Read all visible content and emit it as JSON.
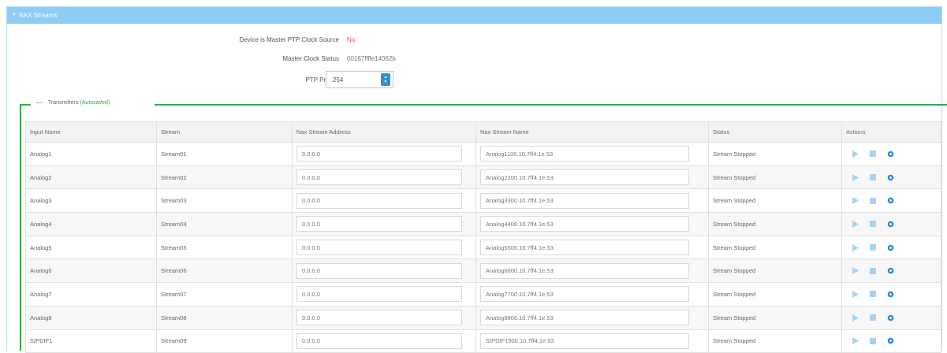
{
  "panel": {
    "title": "NAX Streams"
  },
  "master": {
    "master_label": "Device is Master PTP Clock Source",
    "master_value": "No",
    "status_label": "Master Clock Status",
    "status_value": "00187ffffe14062b",
    "priority_label": "PTP Priority",
    "priority_value": "254"
  },
  "transmitters": {
    "legend": "Transmitters",
    "autosaved": "(Autosaved)",
    "columns": [
      "Input Name",
      "Stream",
      "Nax Stream Address",
      "Nax Stream Name",
      "Status",
      "Actions"
    ],
    "rows": [
      {
        "input": "Analog1",
        "stream": "Stream01",
        "address": "0.0.0.0",
        "name": "Analog1100.10.7ff4.1e.53",
        "status": "Stream Stopped"
      },
      {
        "input": "Analog2",
        "stream": "Stream02",
        "address": "0.0.0.0",
        "name": "Analog2200.10.7ff4.1e.53",
        "status": "Stream Stopped"
      },
      {
        "input": "Analog3",
        "stream": "Stream03",
        "address": "0.0.0.0",
        "name": "Analog3300.10.7ff4.1e.53",
        "status": "Stream Stopped"
      },
      {
        "input": "Analog4",
        "stream": "Stream04",
        "address": "0.0.0.0",
        "name": "Analog4400.10.7ff4.1e.53",
        "status": "Stream Stopped"
      },
      {
        "input": "Analog5",
        "stream": "Stream05",
        "address": "0.0.0.0",
        "name": "Analog5500.10.7ff4.1e.53",
        "status": "Stream Stopped"
      },
      {
        "input": "Analog6",
        "stream": "Stream06",
        "address": "0.0.0.0",
        "name": "Analog6600.10.7ff4.1e.53",
        "status": "Stream Stopped"
      },
      {
        "input": "Analog7",
        "stream": "Stream07",
        "address": "0.0.0.0",
        "name": "Analog7700.10.7ff4.1e.53",
        "status": "Stream Stopped"
      },
      {
        "input": "Analog8",
        "stream": "Stream08",
        "address": "0.0.0.0",
        "name": "Analog8800.10.7ff4.1e.53",
        "status": "Stream Stopped"
      },
      {
        "input": "S/PDIF1",
        "stream": "Stream09",
        "address": "0.0.0.0",
        "name": "S/PDIF1900.10.7ff4.1e.53",
        "status": "Stream Stopped"
      }
    ]
  },
  "icons": {
    "collapse": "caret-down-icon",
    "play": "play-icon",
    "stop": "stop-icon",
    "settings": "gear-icon"
  },
  "colors": {
    "header": "#8ecdf3",
    "accent_green": "#36a84a",
    "no_red": "#d9534f",
    "spin_blue": "#2f8ed6",
    "icon_light_blue": "#a9d1f2",
    "gear_blue": "#2a86d6"
  }
}
